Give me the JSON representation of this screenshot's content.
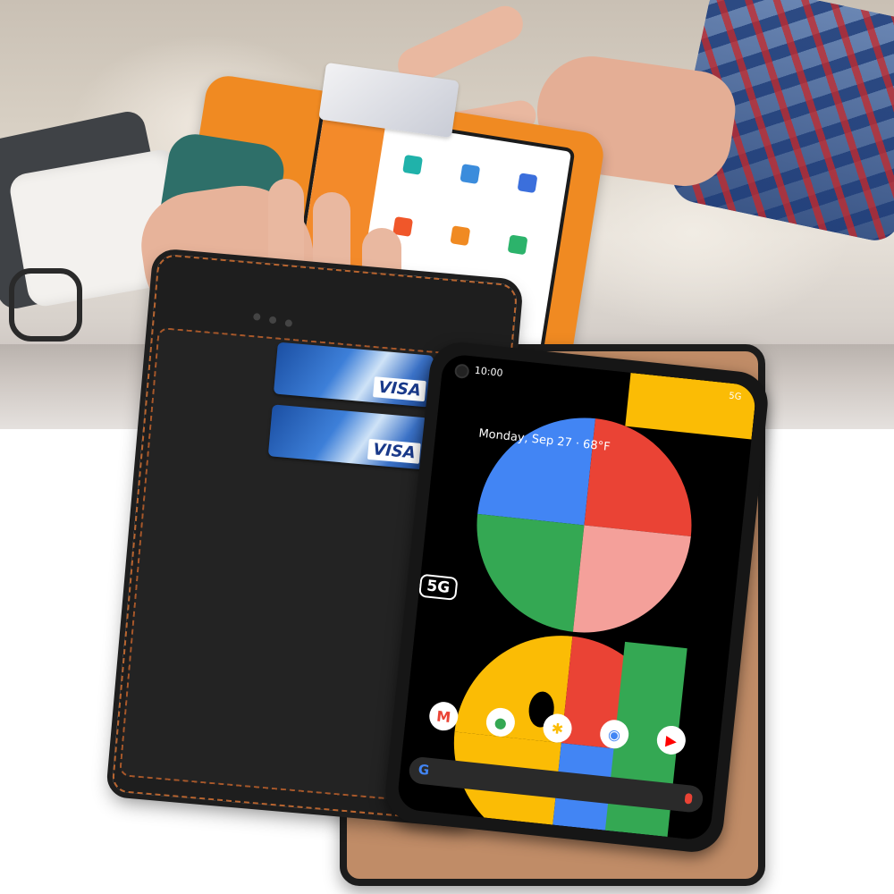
{
  "phone": {
    "status_time": "10:00",
    "status_network": "5G",
    "date_weather": "Monday, Sep 27 · 68°F",
    "badge": "5G",
    "search_logo": "G"
  },
  "cards": [
    {
      "brand": "VISA"
    },
    {
      "brand": "VISA"
    }
  ],
  "dock_apps": [
    {
      "name": "gmail-icon",
      "glyph": "M",
      "color": "#ea4335"
    },
    {
      "name": "maps-icon",
      "glyph": "●",
      "color": "#34a853"
    },
    {
      "name": "photos-icon",
      "glyph": "✱",
      "color": "#fbbc05"
    },
    {
      "name": "chrome-icon",
      "glyph": "◉",
      "color": "#4285f4"
    },
    {
      "name": "youtube-icon",
      "glyph": "▶",
      "color": "#ff0000"
    }
  ],
  "colors": {
    "case_leather": "#1e1e1e",
    "stitching": "#b9642e",
    "case_interior": "#c08c67",
    "pos_orange": "#f08a22",
    "wallpaper_blue": "#4285f4",
    "wallpaper_red": "#ea4335",
    "wallpaper_green": "#34a853",
    "wallpaper_yellow": "#fbbc05",
    "wallpaper_pink": "#f4a09a"
  }
}
